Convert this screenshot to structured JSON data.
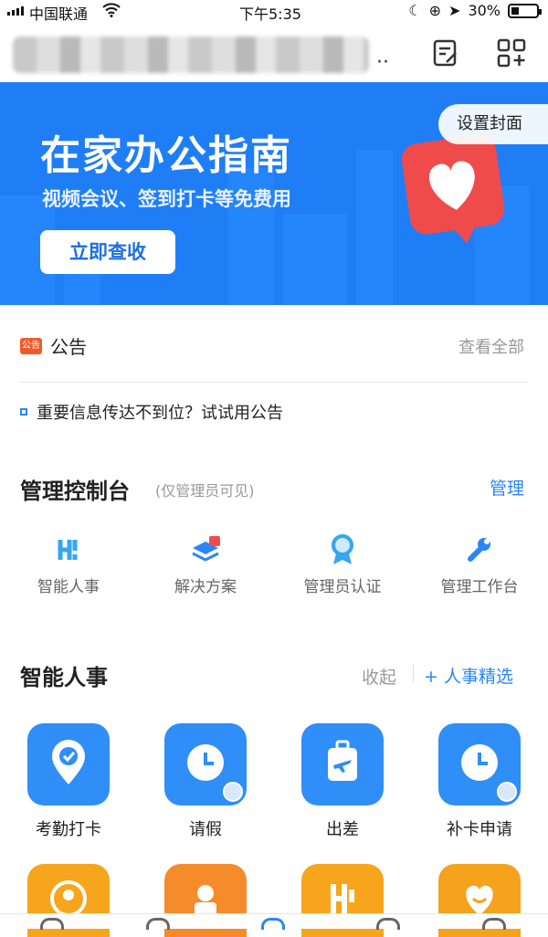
{
  "status_bar": {
    "carrier": "中国联通",
    "time": "下午5:35",
    "battery": "30%"
  },
  "banner": {
    "title": "在家办公指南",
    "subtitle": "视频会议、签到打卡等免费用",
    "button": "立即查收",
    "cover_button": "设置封面",
    "background_color": "#1f7ef5"
  },
  "notice": {
    "badge": "公告",
    "title": "公告",
    "view_all": "查看全部",
    "tip": "重要信息传达不到位？试试用公告"
  },
  "admin_console": {
    "title": "管理控制台",
    "note": "(仅管理员可见)",
    "manage": "管理",
    "items": [
      {
        "label": "智能人事",
        "icon": "hr-icon"
      },
      {
        "label": "解决方案",
        "icon": "solutions-icon"
      },
      {
        "label": "管理员认证",
        "icon": "certificate-icon"
      },
      {
        "label": "管理工作台",
        "icon": "wrench-icon"
      }
    ]
  },
  "smart_hr": {
    "title": "智能人事",
    "collapse": "收起",
    "select": "+ 人事精选",
    "apps": [
      {
        "label": "考勤打卡",
        "icon": "location-check-icon",
        "color": "#2f8ef7"
      },
      {
        "label": "请假",
        "icon": "clock-icon",
        "color": "#2f8ef7"
      },
      {
        "label": "出差",
        "icon": "luggage-plane-icon",
        "color": "#2f8ef7"
      },
      {
        "label": "补卡申请",
        "icon": "clock-icon",
        "color": "#2f8ef7"
      }
    ],
    "apps_row2_colors": [
      "#f7a51c",
      "#f58b2a",
      "#f7a51c",
      "#f5a21c"
    ]
  },
  "accent_color": "#2a86f5"
}
